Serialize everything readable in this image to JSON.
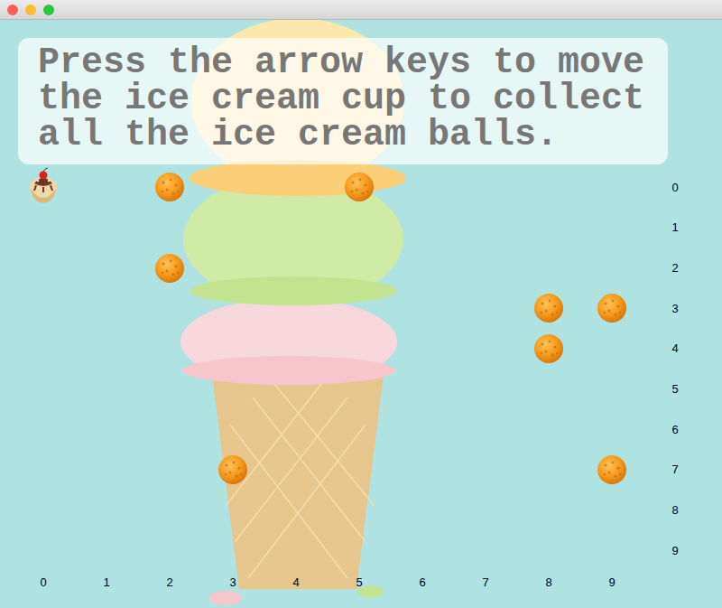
{
  "instructions": "Press the arrow keys to move the ice cream cup to collect all the ice cream balls.",
  "columns": [
    "0",
    "1",
    "2",
    "3",
    "4",
    "5",
    "6",
    "7",
    "8",
    "9"
  ],
  "rows": [
    "0",
    "1",
    "2",
    "3",
    "4",
    "5",
    "6",
    "7",
    "8",
    "9"
  ],
  "player": {
    "col": 0,
    "row": 0
  },
  "balls": [
    {
      "col": 2,
      "row": 0
    },
    {
      "col": 5,
      "row": 0
    },
    {
      "col": 2,
      "row": 2
    },
    {
      "col": 8,
      "row": 3
    },
    {
      "col": 9,
      "row": 3
    },
    {
      "col": 8,
      "row": 4
    },
    {
      "col": 3,
      "row": 7
    },
    {
      "col": 9,
      "row": 7
    }
  ]
}
